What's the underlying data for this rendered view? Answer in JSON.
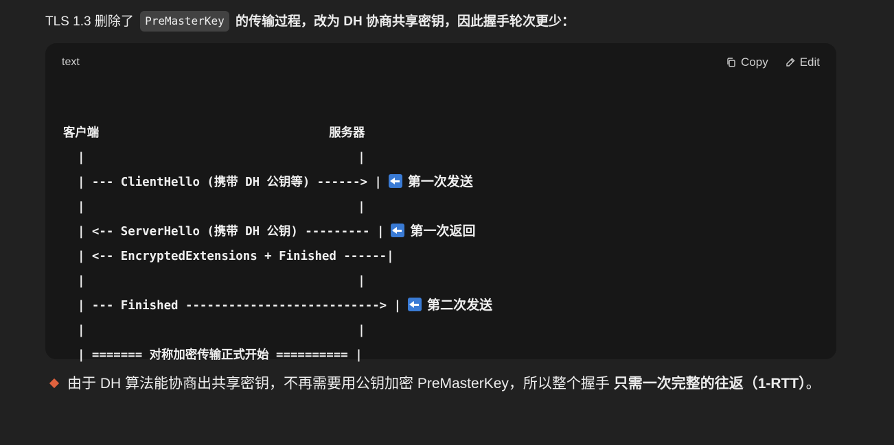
{
  "intro": {
    "prefix": "TLS 1.3 删除了",
    "code": "PreMasterKey",
    "suffix": "的传输过程，改为 DH 协商共享密钥，因此握手轮次更少："
  },
  "codeblock": {
    "language": "text",
    "copy_label": "Copy",
    "edit_label": "Edit",
    "lines": [
      "客户端                                服务器",
      "  |                                      |",
      "  | --- ClientHello (携带 DH 公钥等) ------> |",
      "  |                                      |",
      "  | <-- ServerHello (携带 DH 公钥) --------- |",
      "  | <-- EncryptedExtensions + Finished ------|",
      "  |                                      |",
      "  | --- Finished ---------------------------> |",
      "  |                                      |",
      "  | ======= 对称加密传输正式开始 ========== |"
    ],
    "notes": {
      "line_2": "第一次发送",
      "line_4": "第一次返回",
      "line_7": "第二次发送"
    }
  },
  "outro": {
    "text": "由于 DH 算法能协商出共享密钥，不再需要用公钥加密 PreMasterKey，所以整个握手 ",
    "bold": "只需一次完整的往返（1-RTT）",
    "end": "。"
  }
}
